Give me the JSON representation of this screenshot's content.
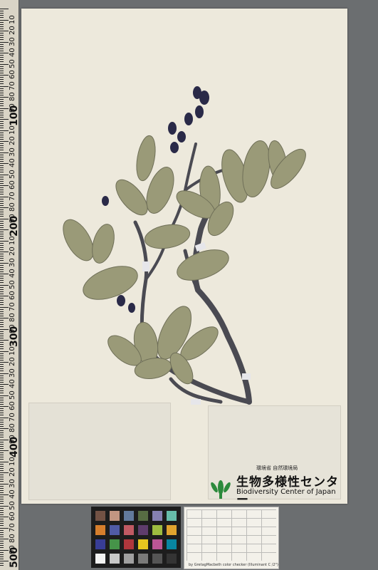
{
  "ruler": {
    "major_labels": [
      "100",
      "200",
      "300",
      "400",
      "500"
    ],
    "minor_labels": [
      "10",
      "20",
      "30",
      "40",
      "50",
      "60",
      "70",
      "80",
      "90"
    ]
  },
  "logo": {
    "ministry_jp": "環境省 自然環境局",
    "center_jp": "生物多様性センター",
    "center_en": "Biodiversity Center of Japan"
  },
  "color_card": {
    "caption": "by GretagMacbeth color checker (Illuminant C /2°)"
  },
  "colors": {
    "sheet": "#ede9dc",
    "leaf": "#9a9a78",
    "stem": "#4a4a52",
    "berry": "#2a2a48",
    "logo_green": "#2c8a3c"
  }
}
